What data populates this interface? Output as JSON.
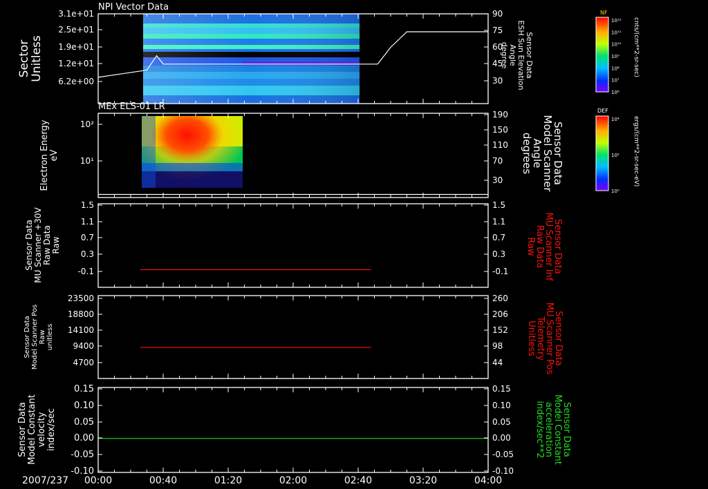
{
  "date_label": "2007/237",
  "x_ticks": [
    "00:00",
    "00:40",
    "01:20",
    "02:00",
    "02:40",
    "03:20",
    "04:00"
  ],
  "colorbars": [
    {
      "title": "NF",
      "unit": "cnts/(cm**2-sr-sec)",
      "labels": [
        "10¹²",
        "10¹¹",
        "10¹⁰",
        "10⁹",
        "10⁸",
        "10⁷",
        "10⁶"
      ]
    },
    {
      "title": "DEF",
      "unit": "ergs/(cm**2-sr-sec-eV)",
      "labels": [
        "10⁴",
        "10²",
        "10⁰"
      ]
    }
  ],
  "colors": {
    "white": "#ffffff",
    "red": "#ff1010",
    "green": "#22dd22"
  },
  "chart_data": [
    {
      "type": "heatmap",
      "title": "NPI Vector Data",
      "ylabel": [
        "Sector",
        "Unitless"
      ],
      "yticks": [
        "3.1e+01",
        "2.5e+01",
        "1.9e+01",
        "1.2e+01",
        "6.2e+00"
      ],
      "y2label": [
        "Sensor Data",
        "ESH Sun Elevation",
        "Angle",
        "degree"
      ],
      "y2ticks": [
        "90",
        "75",
        "60",
        "45",
        "30"
      ],
      "y2lim": [
        15,
        90
      ],
      "heatmap_time_range": [
        "00:26",
        "02:40"
      ],
      "line_series": {
        "name": "ESH Sun Elevation Angle",
        "x_min": [
          0,
          15,
          30,
          36,
          40,
          120,
          155,
          172,
          180,
          190,
          240
        ],
        "y_deg": [
          37,
          40,
          43,
          55,
          48,
          48,
          48,
          48,
          62,
          75,
          75
        ]
      }
    },
    {
      "type": "heatmap",
      "title": "MEx ELS-01 LR",
      "ylabel": [
        "Electron Energy",
        "eV"
      ],
      "yticks": [
        "10²",
        "10¹"
      ],
      "y2label": [
        "Sensor Data",
        "Model Scanner",
        "Angle",
        "degrees"
      ],
      "y2ticks": [
        "190",
        "150",
        "110",
        "70",
        "30"
      ],
      "y2lim": [
        0,
        190
      ],
      "heatmap_time_range": [
        "00:26",
        "01:22"
      ],
      "line_series": {
        "name": "Model Scanner Angle",
        "x_min": [
          0,
          240
        ],
        "y_deg": [
          7,
          7
        ]
      }
    },
    {
      "type": "line",
      "ylabel": [
        "Sensor Data",
        "MU Scanner +30V",
        "Raw Data",
        "Raw"
      ],
      "yticks": [
        "1.5",
        "1.1",
        "0.7",
        "0.3",
        "-0.1"
      ],
      "ylim": [
        -0.4,
        1.5
      ],
      "y2label": [
        "Sensor Data",
        "MU Scanner Inf",
        "Raw Data",
        "Raw"
      ],
      "y2ticks": [
        "1.5",
        "1.1",
        "0.7",
        "0.3",
        "-0.1"
      ],
      "series": [
        {
          "x_min": [
            26,
            168
          ],
          "y": [
            0.0,
            0.0
          ]
        }
      ]
    },
    {
      "type": "line",
      "ylabel": [
        "Sensor Data",
        "Model Scanner Pos",
        "Raw",
        "unitless"
      ],
      "yticks": [
        "23500",
        "18800",
        "14100",
        "9400",
        "4700"
      ],
      "ylim": [
        0,
        23500
      ],
      "y2label": [
        "Sensor Data",
        "MU Scanner Pos",
        "Telemetry",
        "Unitless"
      ],
      "y2ticks": [
        "260",
        "206",
        "152",
        "98",
        "44"
      ],
      "series": [
        {
          "x_min": [
            26,
            168
          ],
          "y": [
            8800,
            8800
          ]
        }
      ]
    },
    {
      "type": "line",
      "ylabel": [
        "Sensor Data",
        "Model Constant",
        "velocity",
        "index/sec"
      ],
      "yticks": [
        "0.15",
        "0.10",
        "0.05",
        "0.00",
        "-0.05",
        "-0.10"
      ],
      "ylim": [
        -0.1,
        0.15
      ],
      "y2label": [
        "Sensor Data",
        "Model Constant",
        "acceleration",
        "index/sec**2"
      ],
      "y2ticks": [
        "0.15",
        "0.10",
        "0.05",
        "0.00",
        "-0.05",
        "-0.10"
      ],
      "series": [
        {
          "x_min": [
            0,
            240
          ],
          "y": [
            0.0,
            0.0
          ]
        }
      ]
    }
  ]
}
